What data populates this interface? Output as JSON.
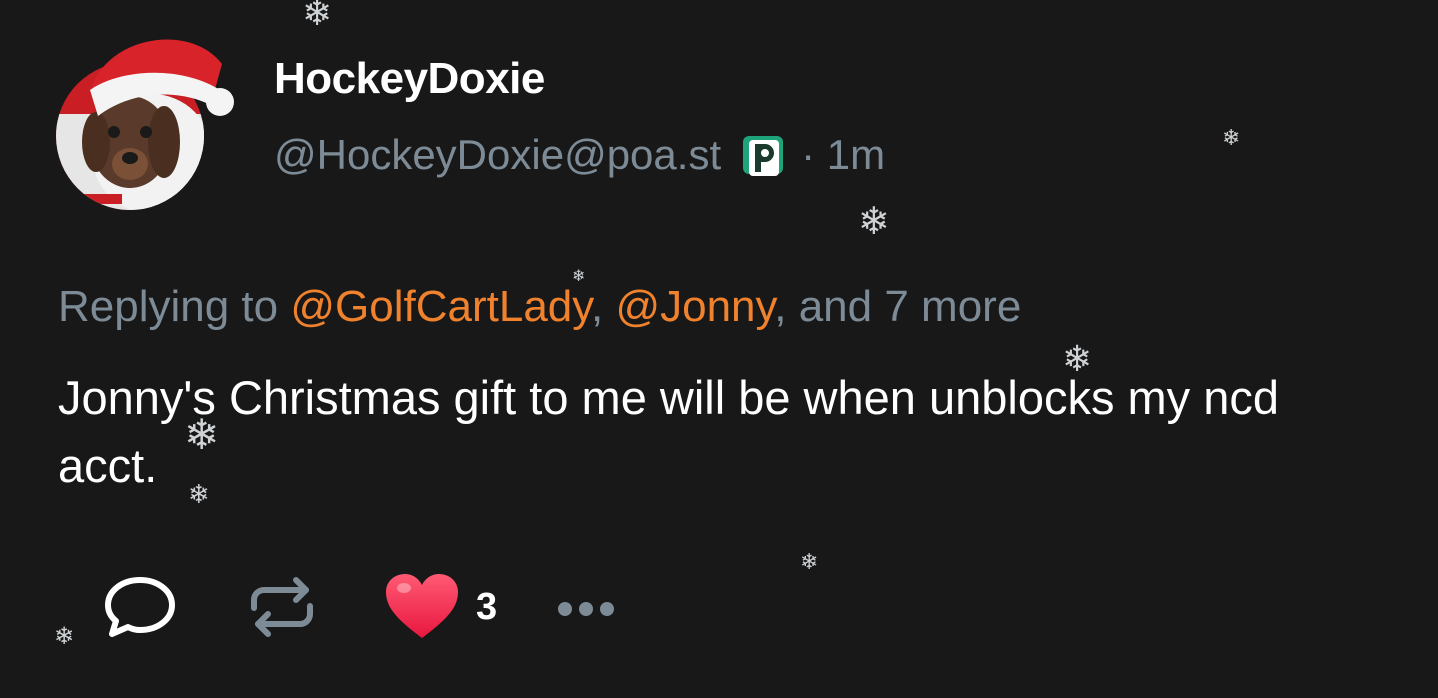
{
  "author": {
    "display_name": "HockeyDoxie",
    "handle": "@HockeyDoxie@poa.st",
    "time": "· 1m"
  },
  "reply": {
    "prefix": "Replying to ",
    "mention1": "@GolfCartLady",
    "sep": ", ",
    "mention2": "@Jonny",
    "suffix": ", and 7 more"
  },
  "body": "Jonny's Christmas gift to me will be when unblocks my ncd acct.",
  "actions": {
    "like_count": "3"
  },
  "icons": {
    "reply": "speech-bubble-icon",
    "boost": "repost-icon",
    "like": "heart-icon",
    "more": "ellipsis-icon",
    "server": "pleroma-p-icon"
  },
  "colors": {
    "background": "#181818",
    "muted": "#7d8b97",
    "mention": "#f0822e",
    "heart": "#ff3b5c"
  },
  "decoration": {
    "snowflake_glyph": "❄"
  }
}
